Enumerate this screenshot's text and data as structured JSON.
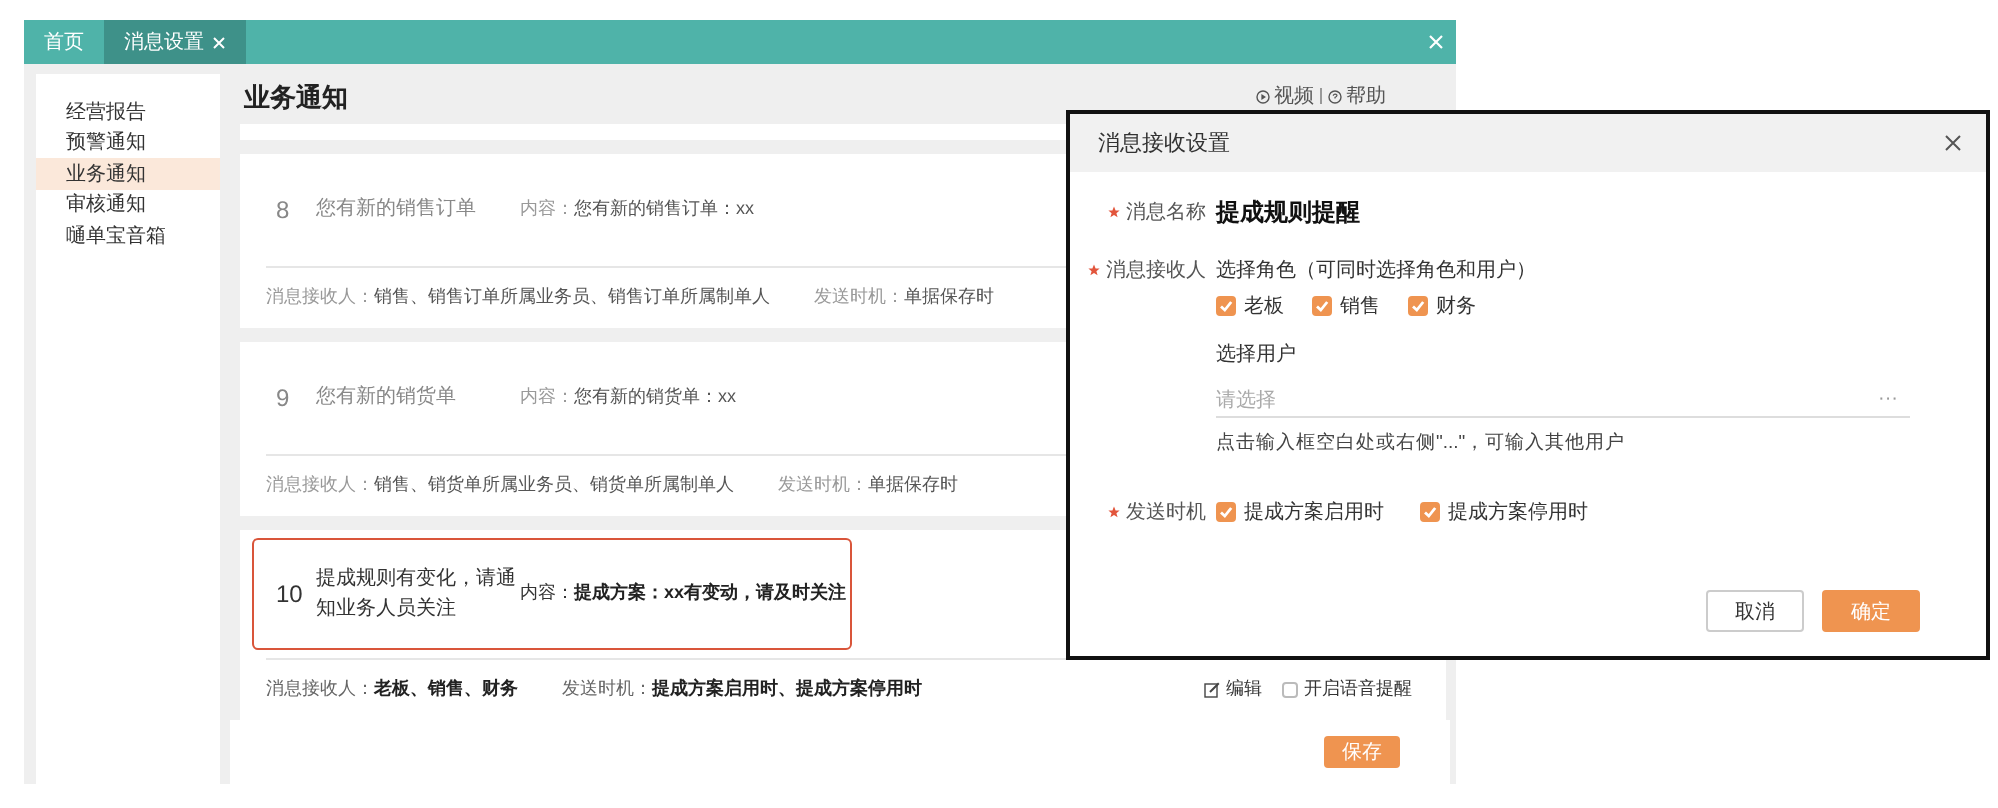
{
  "tabs": [
    {
      "label": "首页",
      "selected": false,
      "closable": false
    },
    {
      "label": "消息设置",
      "selected": true,
      "closable": true
    }
  ],
  "sidebar": {
    "items": [
      {
        "label": "经营报告",
        "selected": false
      },
      {
        "label": "预警通知",
        "selected": false
      },
      {
        "label": "业务通知",
        "selected": true
      },
      {
        "label": "审核通知",
        "selected": false
      },
      {
        "label": "嗵单宝音箱",
        "selected": false
      }
    ]
  },
  "page_title": "业务通知",
  "header_links": [
    {
      "kind": "video",
      "label": "视频"
    },
    {
      "kind": "help",
      "label": "帮助"
    }
  ],
  "notifications": [
    {
      "number": "8",
      "title": "您有新的销售订单",
      "content_label": "内容：",
      "content": "您有新的销售订单：xx",
      "recipients_label": "消息接收人：",
      "recipients": "销售、销售订单所属业务员、销售订单所属制单人",
      "timing_label": "发送时机：",
      "timing": "单据保存时",
      "selected": false
    },
    {
      "number": "9",
      "title": "您有新的销货单",
      "content_label": "内容：",
      "content": "您有新的销货单：xx",
      "recipients_label": "消息接收人：",
      "recipients": "销售、销货单所属业务员、销货单所属制单人",
      "timing_label": "发送时机：",
      "timing": "单据保存时",
      "selected": false
    },
    {
      "number": "10",
      "title": "提成规则有变化，请通知业务人员关注",
      "content_label": "内容：",
      "content": "提成方案：xx有变动，请及时关注",
      "recipients_label": "消息接收人：",
      "recipients": "老板、销售、财务",
      "timing_label": "发送时机：",
      "timing": "提成方案启用时、提成方案停用时",
      "selected": true,
      "edit_label": "编辑",
      "voice_alert": {
        "label": "开启语音提醒",
        "checked": false
      }
    }
  ],
  "save_button": "保存",
  "dialog": {
    "title": "消息接收设置",
    "name_field": {
      "label": "消息名称",
      "required": true,
      "value": "提成规则提醒"
    },
    "recipient_field": {
      "label": "消息接收人",
      "required": true,
      "role_hint": "选择角色（可同时选择角色和用户）",
      "roles": [
        {
          "label": "老板",
          "checked": true
        },
        {
          "label": "销售",
          "checked": true
        },
        {
          "label": "财务",
          "checked": true
        }
      ],
      "user_label": "选择用户",
      "user_placeholder": "请选择",
      "more_button": "···",
      "user_hint": "点击输入框空白处或右侧\"...\"，可输入其他用户"
    },
    "timing_field": {
      "label": "发送时机",
      "required": true,
      "options": [
        {
          "label": "提成方案启用时",
          "checked": true
        },
        {
          "label": "提成方案停用时",
          "checked": true
        }
      ]
    },
    "buttons": [
      {
        "kind": "secondary",
        "label": "取消"
      },
      {
        "kind": "primary",
        "label": "确定"
      }
    ]
  }
}
